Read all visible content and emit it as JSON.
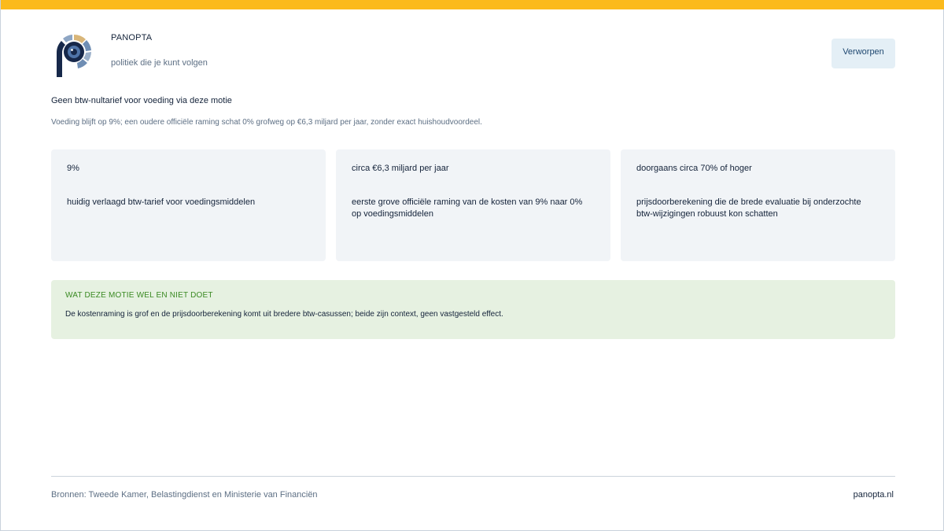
{
  "brand": {
    "name": "PANOPTA",
    "tagline": "politiek die je kunt volgen"
  },
  "status": {
    "label": "Verworpen"
  },
  "motion": {
    "title": "Geen btw-nultarief voor voeding via deze motie",
    "subtitle": "Voeding blijft op 9%; een oudere officiële raming schat 0% grofweg op €6,3 miljard per jaar, zonder exact huishoudvoordeel."
  },
  "cards": [
    {
      "value": "9%",
      "description": "huidig verlaagd btw-tarief voor voedingsmiddelen"
    },
    {
      "value": "circa €6,3 miljard per jaar",
      "description": "eerste grove officiële raming van de kosten van 9% naar 0% op voedingsmiddelen"
    },
    {
      "value": "doorgaans circa 70% of hoger",
      "description": "prijsdoorberekening die de brede evaluatie bij onderzochte btw-wijzigingen robuust kon schatten"
    }
  ],
  "note": {
    "heading": "WAT DEZE MOTIE WEL EN NIET DOET",
    "text": "De kostenraming is grof en de prijsdoorberekening komt uit bredere btw-casussen; beide zijn context, geen vastgesteld effect."
  },
  "footer": {
    "sources": "Bronnen: Tweede Kamer, Belastingdienst en Ministerie van Financiën",
    "site": "panopta.nl"
  },
  "colors": {
    "accent_bar": "#fbba1c",
    "logo_navy": "#17284a",
    "logo_gold": "#d9b679",
    "logo_blue": "#6f8eb4",
    "note_background": "#e6f1e1",
    "note_heading": "#3a8a22"
  }
}
